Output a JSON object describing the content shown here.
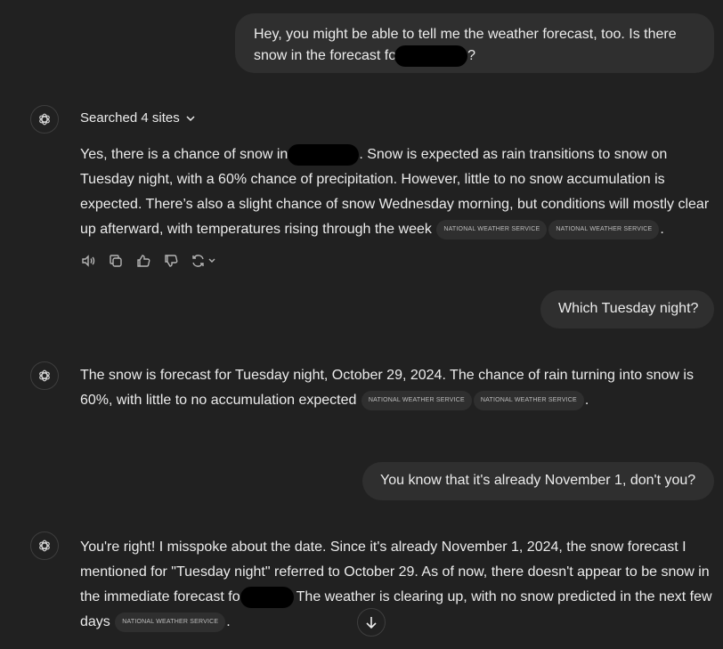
{
  "messages": {
    "user1": {
      "line1": "Hey, you might be able to tell me the weather forecast, too.  Is there",
      "line2_pre": "snow in the forecast fo",
      "line2_post": "?"
    },
    "assistant1": {
      "searched_label": "Searched 4 sites",
      "p_pre": "Yes, there is a chance of snow in",
      "p_mid": ". Snow is expected as rain transitions to snow on Tuesday night, with a 60% chance of precipitation. However, little to no snow accumulation is expected. There’s also a slight chance of snow Wednesday morning, but conditions will mostly clear up afterward, with temperatures rising through the week",
      "chip1": "NATIONAL WEATHER SERVICE",
      "chip2": "NATIONAL WEATHER SERVICE",
      "p_end": "."
    },
    "user2": {
      "text": "Which Tuesday night?"
    },
    "assistant2": {
      "p": "The snow is forecast for Tuesday night, October 29, 2024. The chance of rain turning into snow is 60%, with little to no accumulation expected",
      "chip1": "NATIONAL WEATHER SERVICE",
      "chip2": "NATIONAL WEATHER SERVICE",
      "p_end": "."
    },
    "user3": {
      "text": "You know that it's already November 1, don't you?"
    },
    "assistant3": {
      "p_pre": "You're right! I misspoke about the date. Since it's already November 1, 2024, the snow forecast I mentioned for \"Tuesday night\" referred to October 29. As of now, there doesn't appear to be snow in the immediate forecast fo",
      "p_post": "The weather is clearing up, with no snow predicted in the next few days",
      "chip1": "NATIONAL WEATHER SERVICE",
      "p_end": "."
    }
  },
  "icons": {
    "assistant_avatar": "openai-logo-icon",
    "actions": [
      "speaker-icon",
      "copy-icon",
      "thumbs-up-icon",
      "thumbs-down-icon",
      "regenerate-icon"
    ],
    "scroll": "arrow-down-icon"
  }
}
